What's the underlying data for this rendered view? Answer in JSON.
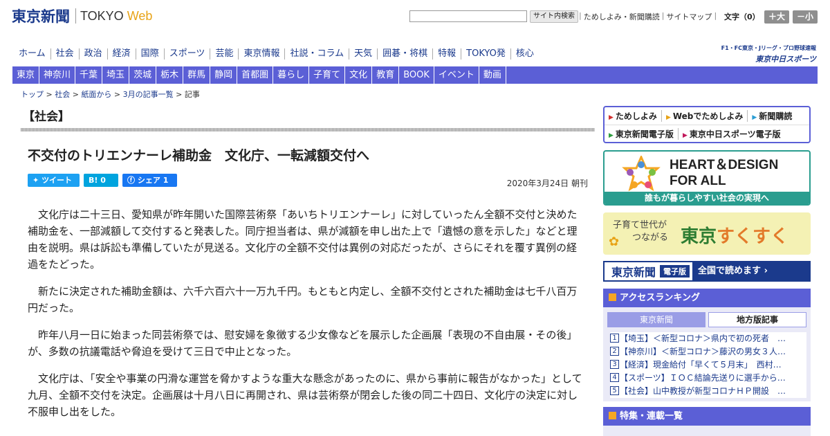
{
  "header": {
    "logo_ja": "東京新聞",
    "logo_en": "TOKYO",
    "logo_web": "Web",
    "search_button": "サイト内検索",
    "top_links": [
      "ためしよみ・新聞購読",
      "サイトマップ"
    ],
    "font_label": "文字（0）",
    "font_bigger": "＋大",
    "font_smaller": "－小"
  },
  "nav_main": [
    "ホーム",
    "社会",
    "政治",
    "経済",
    "国際",
    "スポーツ",
    "芸能",
    "東京情報",
    "社説・コラム",
    "天気",
    "囲碁・将棋",
    "特報",
    "TOKYO発",
    "核心"
  ],
  "chunichi_sports": {
    "sub": "F1・FC東京・Jリーグ・プロ野球速報",
    "name": "東京中日スポーツ"
  },
  "nav_regional": [
    "東京",
    "神奈川",
    "千葉",
    "埼玉",
    "茨城",
    "栃木",
    "群馬",
    "静岡",
    "首都圏",
    "暮らし",
    "子育て",
    "文化",
    "教育",
    "BOOK",
    "イベント",
    "動画"
  ],
  "breadcrumb": [
    "トップ",
    "社会",
    "紙面から",
    "3月の記事一覧",
    "記事"
  ],
  "section_title": "【社会】",
  "article": {
    "headline": "不交付のトリエンナーレ補助金　文化庁、一転減額交付へ",
    "date": "2020年3月24日 朝刊",
    "paragraphs": [
      "文化庁は二十三日、愛知県が昨年開いた国際芸術祭「あいちトリエンナーレ」に対していったん全額不交付と決めた補助金を、一部減額して交付すると発表した。同庁担当者は、県が減額を申し出た上で「遺憾の意を示した」などと理由を説明。県は訴訟も準備していたが見送る。文化庁の全額不交付は異例の対応だったが、さらにそれを覆す異例の経過をたどった。",
      "新たに決定された補助金額は、六千六百六十一万九千円。もともと内定し、全額不交付とされた補助金は七千八百万円だった。",
      "昨年八月一日に始まった同芸術祭では、慰安婦を象徴する少女像などを展示した企画展「表現の不自由展・その後」が、多数の抗議電話や脅迫を受けて三日で中止となった。",
      "文化庁は、「安全や事業の円滑な運営を脅かすような重大な懸念があったのに、県から事前に報告がなかった」として九月、全額不交付を決定。企画展は十月八日に再開され、県は芸術祭が閉会した後の同二十四日、文化庁の決定に対し不服申し出をした。"
    ]
  },
  "social": {
    "tweet": "ツイート",
    "hatena": "B!",
    "hatena_count": "0",
    "share": "シェア",
    "share_count": "1"
  },
  "sidebar": {
    "links_row1": [
      "ためしよみ",
      "Webでためしよみ",
      "新聞購読"
    ],
    "links_row2": [
      "東京新聞電子版",
      "東京中日スポーツ電子版"
    ],
    "heart_title_1": "HEART＆DESIGN",
    "heart_title_2": "FOR ALL",
    "heart_caption": "誰もが暮らしやすい社会の実現へ",
    "sukusuku_line1": "子育て世代が",
    "sukusuku_line2": "つながる",
    "sukusuku_title_a": "東京",
    "sukusuku_title_b": "すくすく",
    "denshi_name": "東京新聞",
    "denshi_badge": "電子版",
    "denshi_text": "全国で読めます",
    "ranking_title": "アクセスランキング",
    "ranking_tab_a": "東京新聞",
    "ranking_tab_b": "地方版記事",
    "ranking": [
      "【埼玉】＜新型コロナ＞県内で初の死者　…",
      "【神奈川】＜新型コロナ＞藤沢の男女３人…",
      "【経済】現金給付「早くて５月末」　西村…",
      "【スポーツ】ＩＯＣ結論先送りに選手から…",
      "【社会】山中教授が新型コロナＨＰ開設　…"
    ],
    "feature_title": "特集・連載一覧"
  },
  "colors": {
    "brand_navy": "#1b3a8c",
    "nav_purple": "#5b5fd6",
    "accent_orange": "#e8a317",
    "heart_teal": "#2a9d8f"
  }
}
